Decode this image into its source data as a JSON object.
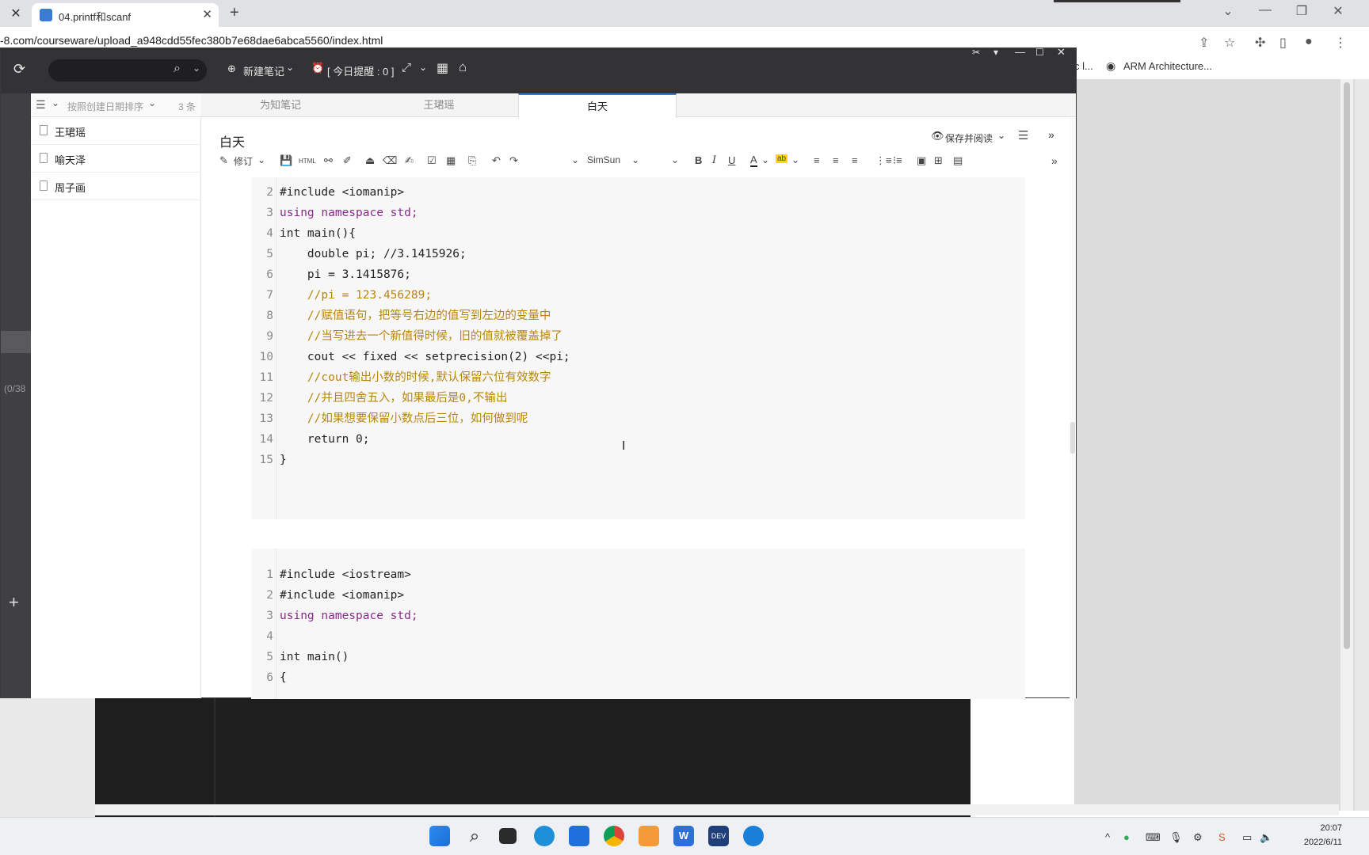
{
  "browser": {
    "tab_title": "04.printf和scanf",
    "url": "-8.com/courseware/upload_a948cdd55fec380b7e68dae6abca5560/index.html",
    "bookmark_partial": "c l...",
    "bookmark": "ARM Architecture..."
  },
  "app": {
    "toolbar": {
      "new_note": "新建笔记",
      "reminder": "[ 今日提醒 : 0 ]"
    },
    "left_strip": {
      "count": "(0/38"
    },
    "notelist": {
      "sort": "按照创建日期排序",
      "count": "3 条",
      "items": [
        {
          "title": "王珺瑶"
        },
        {
          "title": "喻天泽"
        },
        {
          "title": "周子画"
        }
      ]
    },
    "tabs": [
      {
        "label": "为知笔记"
      },
      {
        "label": "王珺瑶"
      },
      {
        "label": "白天"
      }
    ],
    "note": {
      "title": "白天",
      "save_read": "保存并阅读",
      "edit": "修订",
      "html": "HTML",
      "font": "SimSun"
    }
  },
  "code1": [
    {
      "n": "2",
      "t": "#include <iomanip>"
    },
    {
      "n": "3",
      "t": "using namespace std;"
    },
    {
      "n": "4",
      "t": "int main(){"
    },
    {
      "n": "5",
      "t": "    double pi; //3.1415926;"
    },
    {
      "n": "6",
      "t": "    pi = 3.1415876;"
    },
    {
      "n": "7",
      "t": "    //pi = 123.456289;"
    },
    {
      "n": "8",
      "t": "    //赋值语句，把等号右边的值写到左边的变量中"
    },
    {
      "n": "9",
      "t": "    //当写进去一个新值得时候，旧的值就被覆盖掉了"
    },
    {
      "n": "10",
      "t": "    cout << fixed << setprecision(2) <<pi;"
    },
    {
      "n": "11",
      "t": "    //cout输出小数的时候,默认保留六位有效数字"
    },
    {
      "n": "12",
      "t": "    //并且四舍五入，如果最后是0,不输出"
    },
    {
      "n": "13",
      "t": "    //如果想要保留小数点后三位，如何做到呢"
    },
    {
      "n": "14",
      "t": "    return 0;"
    },
    {
      "n": "15",
      "t": "}"
    }
  ],
  "code2": [
    {
      "n": "1",
      "t": "#include <iostream>"
    },
    {
      "n": "2",
      "t": "#include <iomanip>"
    },
    {
      "n": "3",
      "t": "using namespace std;"
    },
    {
      "n": "4",
      "t": ""
    },
    {
      "n": "5",
      "t": "int main()"
    },
    {
      "n": "6",
      "t": "{"
    }
  ],
  "taskbar": {
    "time": "20:07",
    "date": "2022/6/11"
  }
}
